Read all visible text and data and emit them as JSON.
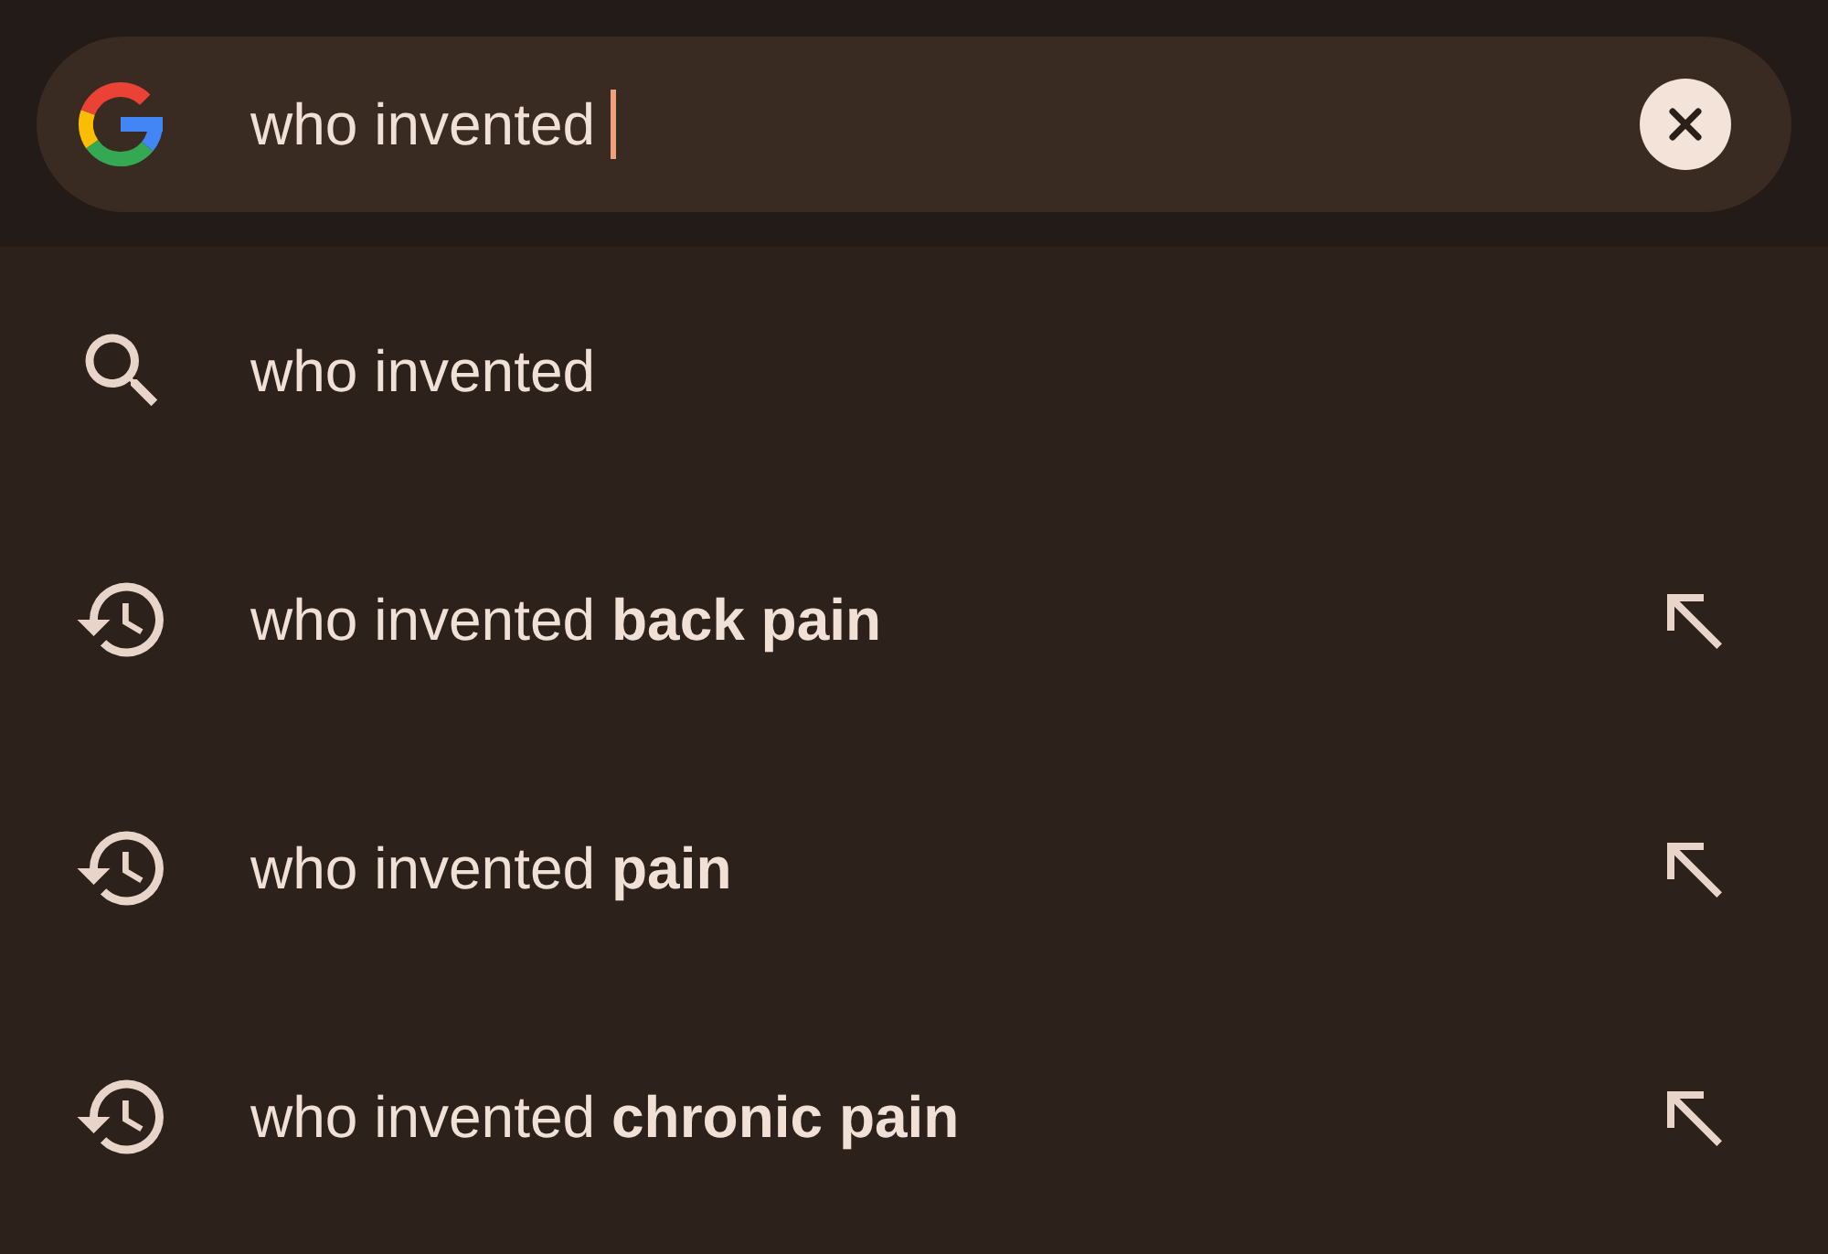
{
  "search": {
    "value": "who invented",
    "focused": true
  },
  "suggestions": [
    {
      "kind": "search",
      "text": "who invented"
    },
    {
      "kind": "history",
      "text": "who invented **back pain**"
    },
    {
      "kind": "history",
      "text": "who invented **pain**"
    },
    {
      "kind": "history",
      "text": "who invented **chronic pain**"
    }
  ]
}
